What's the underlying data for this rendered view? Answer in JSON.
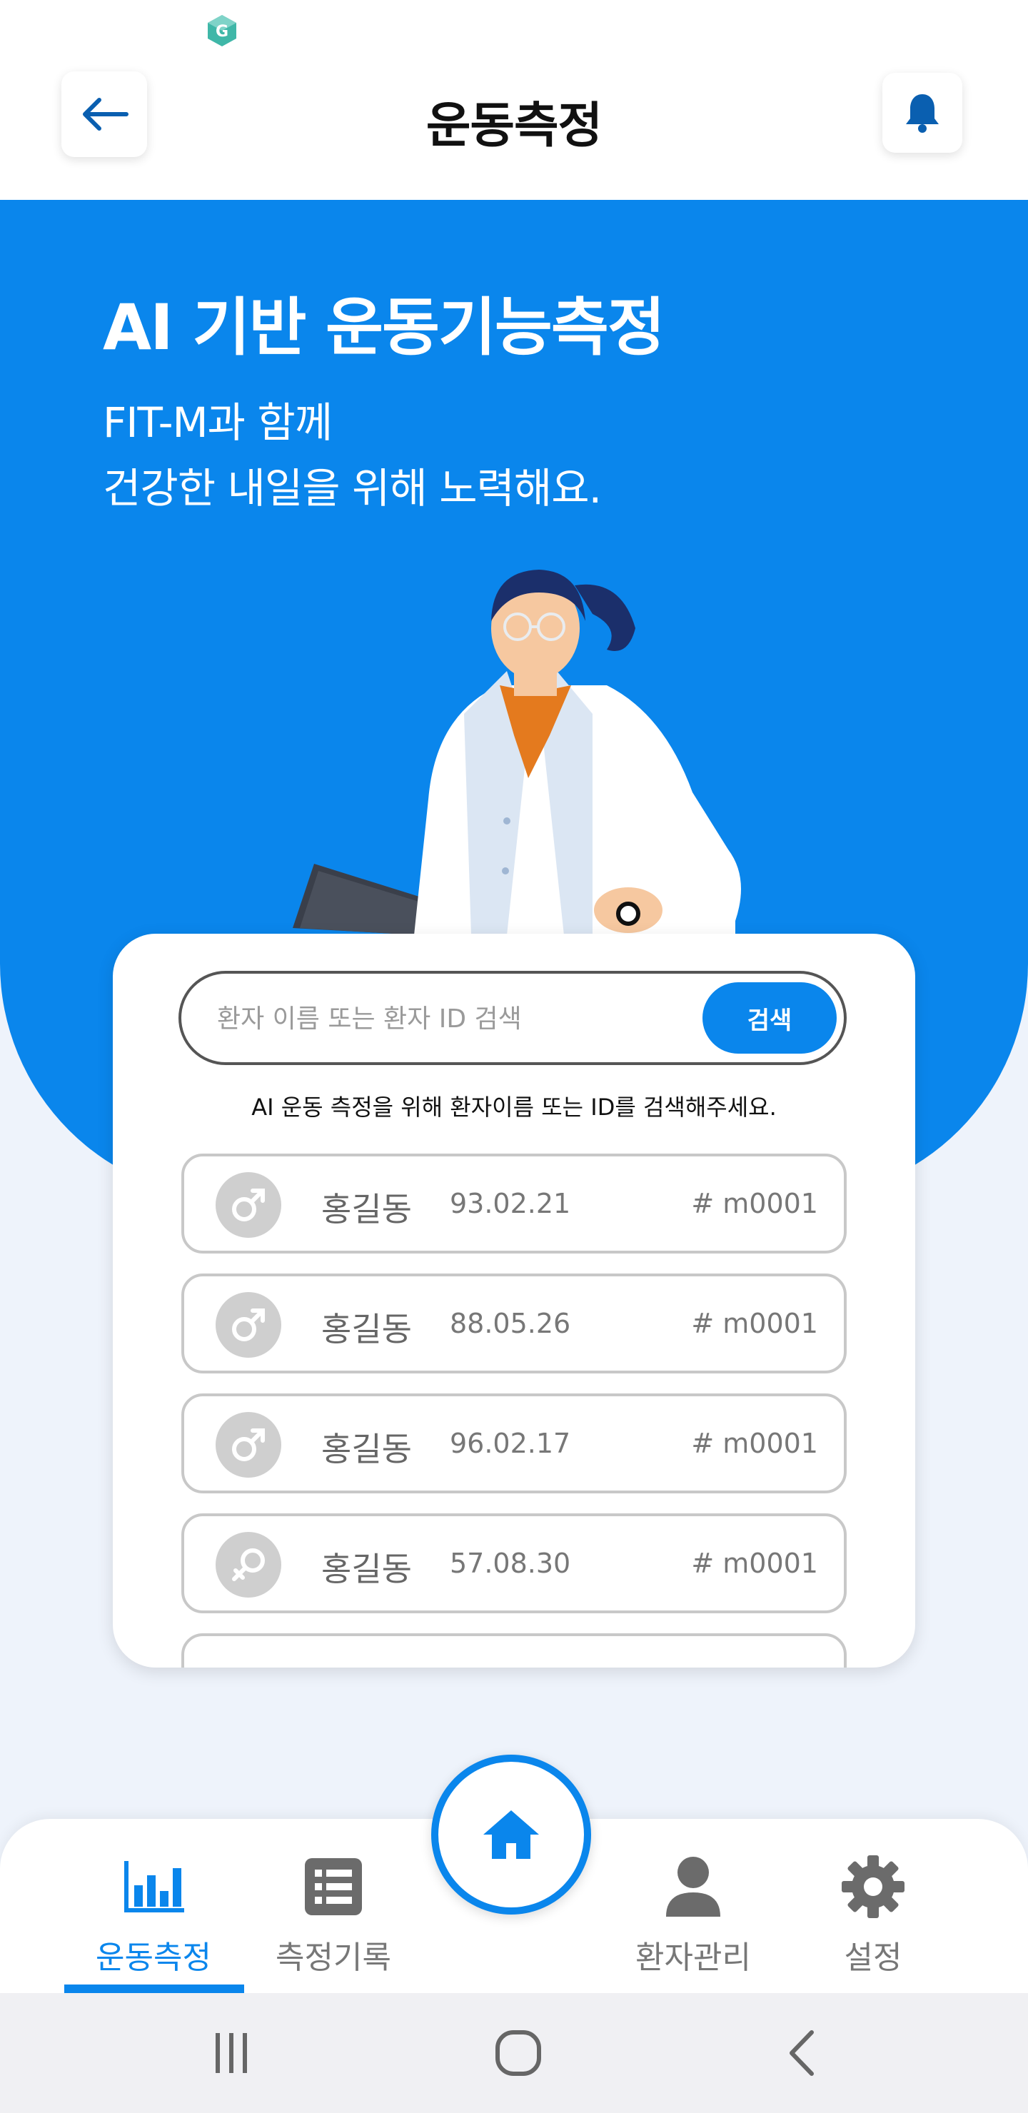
{
  "header": {
    "title": "운동측정",
    "back_icon": "back-arrow-icon",
    "notification_icon": "bell-icon"
  },
  "hero": {
    "title": "AI 기반 운동기능측정",
    "subtitle_line1": "FIT-M과 함께",
    "subtitle_line2": "건강한 내일을 위해 노력해요."
  },
  "search": {
    "placeholder": "환자 이름 또는 환자 ID 검색",
    "button_label": "검색",
    "hint": "AI 운동 측정을 위해 환자이름 또는 ID를 검색해주세요."
  },
  "patients": [
    {
      "gender": "male",
      "name": "홍길동",
      "dob": "93.02.21",
      "id": "# m0001"
    },
    {
      "gender": "male",
      "name": "홍길동",
      "dob": "88.05.26",
      "id": "# m0001"
    },
    {
      "gender": "male",
      "name": "홍길동",
      "dob": "96.02.17",
      "id": "# m0001"
    },
    {
      "gender": "female",
      "name": "홍길동",
      "dob": "57.08.30",
      "id": "# m0001"
    }
  ],
  "bottom_nav": {
    "items": [
      {
        "label": "운동측정",
        "icon": "bar-chart-icon",
        "active": true
      },
      {
        "label": "측정기록",
        "icon": "list-icon",
        "active": false
      },
      {
        "label": "환자관리",
        "icon": "person-icon",
        "active": false
      },
      {
        "label": "설정",
        "icon": "gear-icon",
        "active": false
      }
    ],
    "home_icon": "home-icon"
  },
  "colors": {
    "primary": "#0a86ec",
    "background": "#eef3fb"
  }
}
